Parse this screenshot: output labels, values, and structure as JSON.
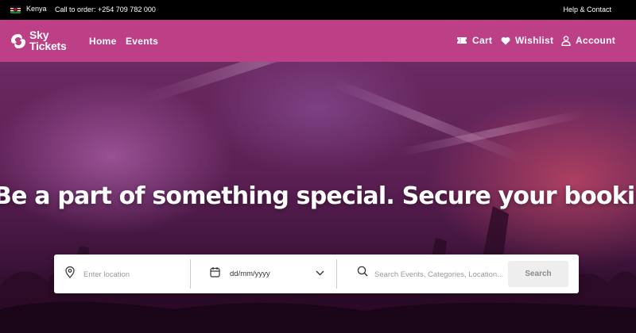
{
  "topbar": {
    "country": "Kenya",
    "phone": "Call to order: +254 709 782 000",
    "help": "Help & Contact"
  },
  "brand": {
    "line1": "Sky",
    "line2": "Tickets"
  },
  "nav": {
    "home": "Home",
    "events": "Events",
    "cart": "Cart",
    "wishlist": "Wishlist",
    "account": "Account"
  },
  "hero": {
    "headline": "Be a part of something special. Secure your booking now"
  },
  "search": {
    "location_placeholder": "Enter location",
    "date_value": "dd/mm/yyyy",
    "query_placeholder": "Search Events, Categories, Location...",
    "button": "Search"
  },
  "colors": {
    "brand": "#bd4087",
    "topbar": "#000000"
  }
}
